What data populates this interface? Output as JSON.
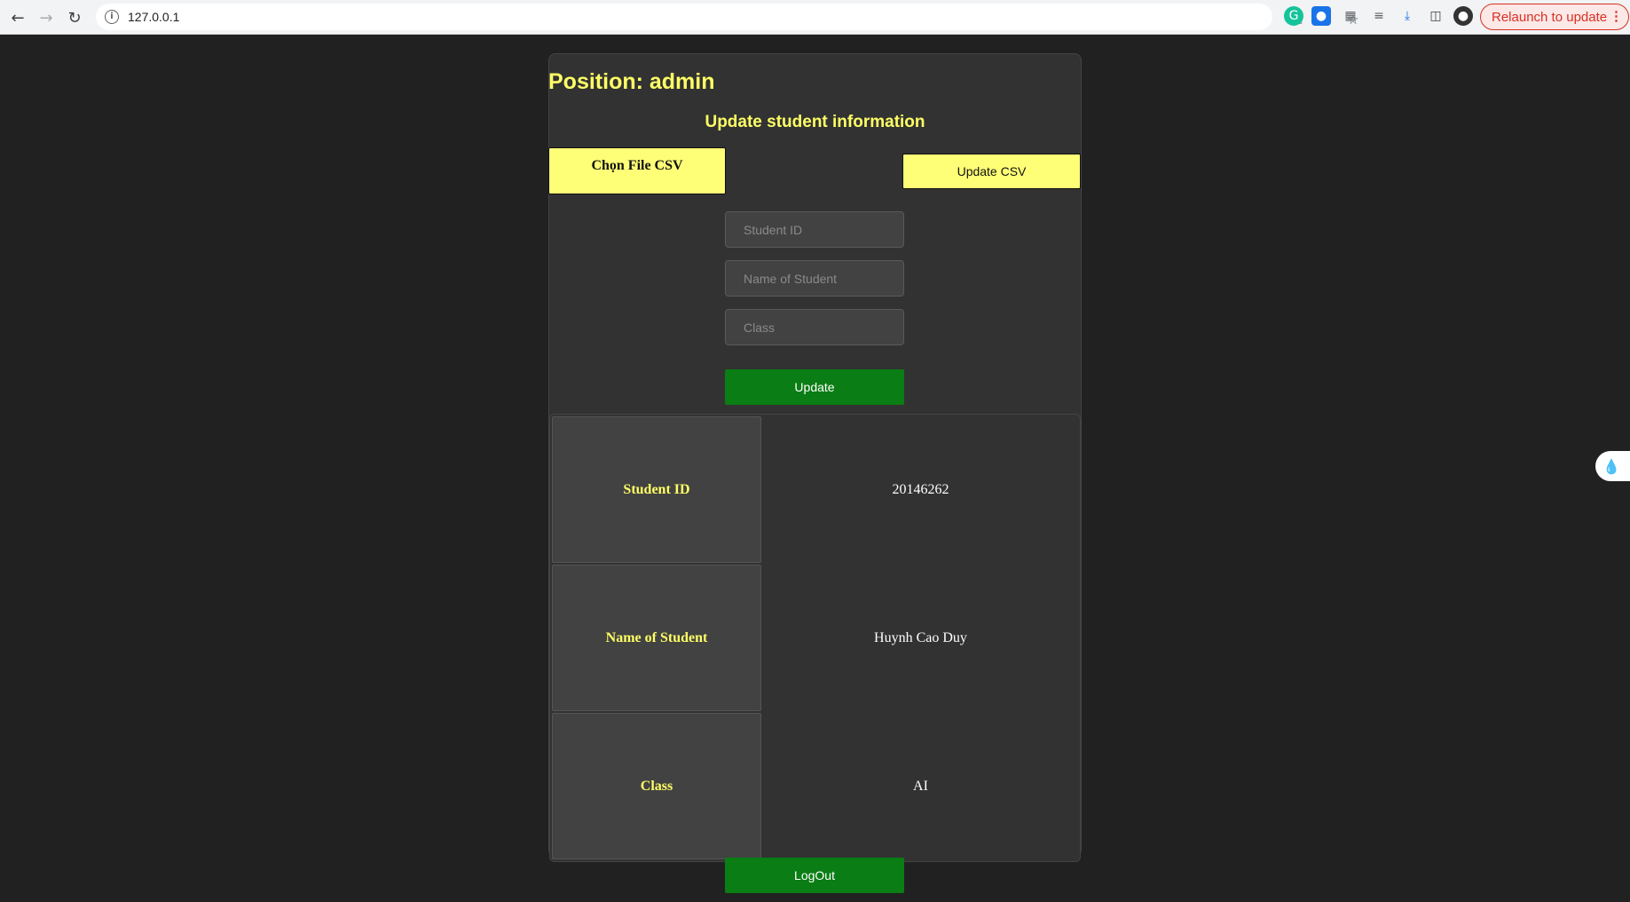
{
  "browser": {
    "url": "127.0.0.1",
    "relaunch_label": "Relaunch to update",
    "icons": [
      "back-icon",
      "forward-icon",
      "reload-icon",
      "site-info-icon",
      "key-icon",
      "share-icon",
      "star-icon",
      "grammarly-icon",
      "extension-drop-icon",
      "puzzle-icon",
      "media-queue-icon",
      "download-icon",
      "sidebar-icon",
      "profile-avatar"
    ]
  },
  "page": {
    "position_label": "Position: admin",
    "section_title": "Update student information",
    "choose_file_label": "Chọn File CSV",
    "update_csv_label": "Update CSV",
    "fields": {
      "student_id_placeholder": "Student ID",
      "name_placeholder": "Name of Student",
      "class_placeholder": "Class"
    },
    "update_label": "Update",
    "logout_label": "LogOut"
  },
  "student_table": {
    "rows": [
      {
        "label": "Student ID",
        "value": "20146262"
      },
      {
        "label": "Name of Student",
        "value": "Huynh Cao Duy"
      },
      {
        "label": "Class",
        "value": "AI"
      }
    ]
  },
  "colors": {
    "background": "#212121",
    "panel": "#323232",
    "accent_yellow": "#ffff66",
    "button_green": "#0a7d14"
  }
}
